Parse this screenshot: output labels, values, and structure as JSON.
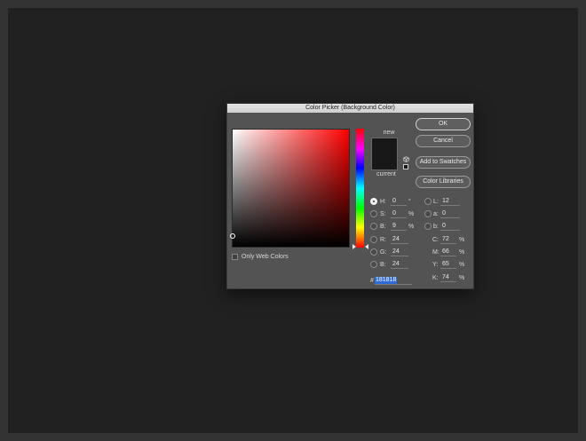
{
  "dialog": {
    "title": "Color Picker (Background Color)"
  },
  "picker": {
    "only_web_colors_label": "Only Web Colors",
    "new_label": "new",
    "current_label": "current",
    "new_color": "#181818",
    "current_color": "#181818"
  },
  "buttons": {
    "ok": "OK",
    "cancel": "Cancel",
    "add_to_swatches": "Add to Swatches",
    "color_libraries": "Color Libraries"
  },
  "hsb": {
    "h": {
      "label": "H:",
      "value": "0",
      "unit": "°"
    },
    "s": {
      "label": "S:",
      "value": "0",
      "unit": "%"
    },
    "b": {
      "label": "B:",
      "value": "9",
      "unit": "%"
    }
  },
  "rgb": {
    "r": {
      "label": "R:",
      "value": "24"
    },
    "g": {
      "label": "G:",
      "value": "24"
    },
    "b": {
      "label": "B:",
      "value": "24"
    }
  },
  "lab": {
    "l": {
      "label": "L:",
      "value": "12"
    },
    "a": {
      "label": "a:",
      "value": "0"
    },
    "b": {
      "label": "b:",
      "value": "0"
    }
  },
  "cmyk": {
    "c": {
      "label": "C:",
      "value": "72",
      "unit": "%"
    },
    "m": {
      "label": "M:",
      "value": "66",
      "unit": "%"
    },
    "y": {
      "label": "Y:",
      "value": "65",
      "unit": "%"
    },
    "k": {
      "label": "K:",
      "value": "74",
      "unit": "%"
    }
  },
  "hex": {
    "label": "#",
    "value": "181818"
  },
  "colors": {
    "hue_base": "#ff0000",
    "selection": "#2f6bd6"
  }
}
